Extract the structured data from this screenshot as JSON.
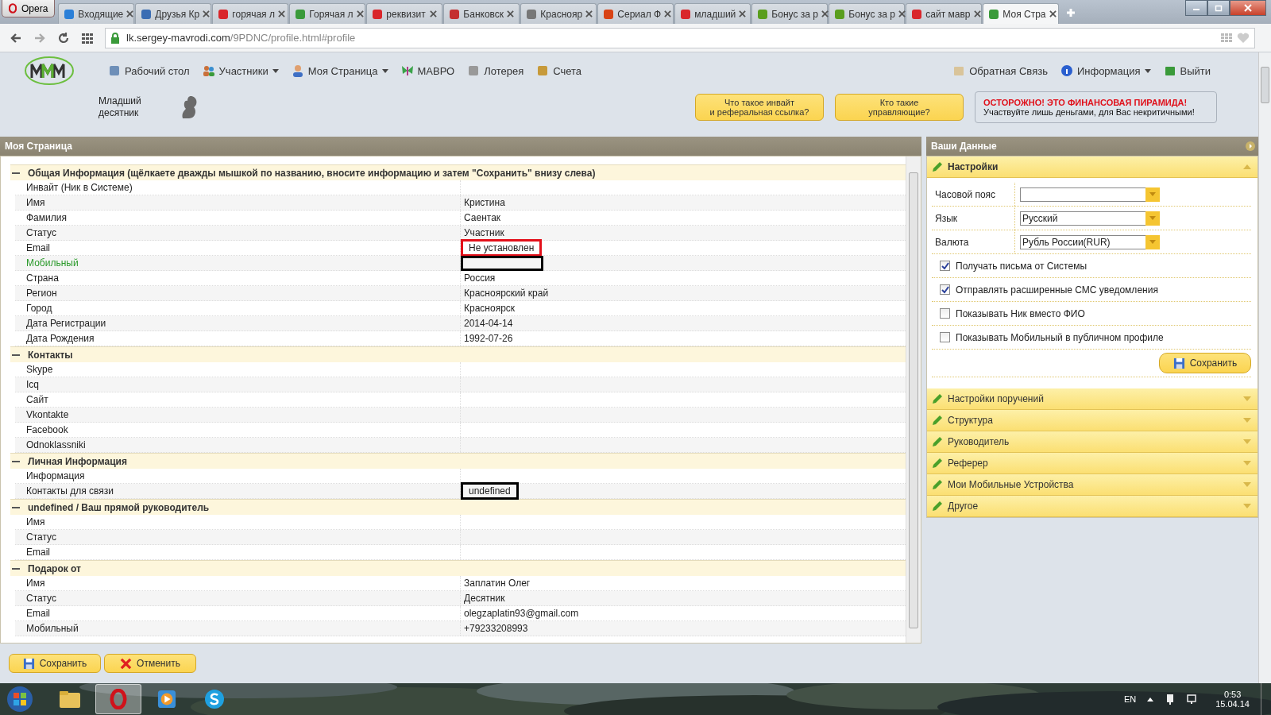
{
  "browser": {
    "menu_label": "Opera",
    "tabs": [
      {
        "label": "Входящие",
        "selected": false
      },
      {
        "label": "Друзья Кр",
        "selected": false
      },
      {
        "label": "горячая л",
        "selected": false
      },
      {
        "label": "Горячая л",
        "selected": false
      },
      {
        "label": "реквизит",
        "selected": false
      },
      {
        "label": "Банковск",
        "selected": false
      },
      {
        "label": "Краснояр",
        "selected": false
      },
      {
        "label": "Сериал Ф",
        "selected": false
      },
      {
        "label": "младший",
        "selected": false
      },
      {
        "label": "Бонус за р",
        "selected": false
      },
      {
        "label": "Бонус за р",
        "selected": false
      },
      {
        "label": "сайт мавр",
        "selected": false
      },
      {
        "label": "Моя Стра",
        "selected": true
      }
    ],
    "address": {
      "host": "lk.sergey-mavrodi.com",
      "path": "/9PDNC/profile.html#profile"
    }
  },
  "nav": {
    "left": [
      {
        "label": "Рабочий стол",
        "dropdown": false
      },
      {
        "label": "Участники",
        "dropdown": true
      },
      {
        "label": "Моя Страница",
        "dropdown": true
      },
      {
        "label": "МАВРО",
        "dropdown": false
      },
      {
        "label": "Лотерея",
        "dropdown": false
      },
      {
        "label": "Счета",
        "dropdown": false
      }
    ],
    "right": [
      {
        "label": "Обратная Связь",
        "dropdown": false
      },
      {
        "label": "Информация",
        "dropdown": true
      },
      {
        "label": "Выйти",
        "dropdown": false
      }
    ]
  },
  "rank": "Младший десятник",
  "help_buttons": [
    [
      "Что такое инвайт",
      "и реферальная ссылка?"
    ],
    [
      "Кто такие",
      "управляющие?"
    ]
  ],
  "warning": {
    "title": "ОСТОРОЖНО! ЭТО ФИНАНСОВАЯ ПИРАМИДА!",
    "text": "Участвуйте лишь деньгами, для Вас некритичными!"
  },
  "profile": {
    "title": "Моя Страница",
    "sections": [
      {
        "title": "Общая Информация (щёлкаете дважды мышкой по названию, вносите информацию и затем \"Сохранить\" внизу слева)",
        "expanded": true,
        "rows": [
          {
            "label": "Инвайт (Ник в Системе)"
          },
          {
            "label": "Имя",
            "value": "Кристина"
          },
          {
            "label": "Фамилия",
            "value": "Саентак"
          },
          {
            "label": "Статус",
            "value": "Участник"
          },
          {
            "label": "Email",
            "value": "Не установлен",
            "color": "#e3101a"
          },
          {
            "label": "Мобильный",
            "highlighted": true,
            "color": "#000000"
          },
          {
            "label": "Страна",
            "value": "Россия"
          },
          {
            "label": "Регион",
            "value": "Красноярский край"
          },
          {
            "label": "Город",
            "value": "Красноярск"
          },
          {
            "label": "Дата Регистрации",
            "value": "2014-04-14"
          },
          {
            "label": "Дата Рождения",
            "value": "1992-07-26"
          }
        ]
      },
      {
        "title": "Контакты",
        "expanded": true,
        "rows": [
          {
            "label": "Skype"
          },
          {
            "label": "Icq"
          },
          {
            "label": "Сайт"
          },
          {
            "label": "Vkontakte"
          },
          {
            "label": "Facebook"
          },
          {
            "label": "Odnoklassniki"
          }
        ]
      },
      {
        "title": "Личная Информация",
        "expanded": true,
        "rows": [
          {
            "label": "Информация"
          },
          {
            "label": "Контакты для связи",
            "value": "undefined",
            "color": "#000000"
          }
        ]
      },
      {
        "title": "undefined / Ваш прямой руководитель",
        "expanded": true,
        "rows": [
          {
            "label": "Имя"
          },
          {
            "label": "Статус"
          },
          {
            "label": "Email"
          }
        ]
      },
      {
        "title": "Подарок от",
        "expanded": true,
        "rows": [
          {
            "label": "Имя",
            "value": "Заплатин Олег"
          },
          {
            "label": "Статус",
            "value": "Десятник"
          },
          {
            "label": "Email",
            "value": "olegzaplatin93@gmail.com"
          },
          {
            "label": "Мобильный",
            "value": "+79233208993"
          }
        ]
      }
    ],
    "buttons": [
      {
        "label": "Сохранить",
        "kind": "save"
      },
      {
        "label": "Отменить",
        "kind": "cancel"
      }
    ]
  },
  "your_data": {
    "title": "Ваши Данные",
    "accordion": [
      {
        "title": "Настройки",
        "expanded": true
      },
      {
        "title": "Настройки поручений",
        "expanded": false
      },
      {
        "title": "Структура",
        "expanded": false
      },
      {
        "title": "Руководитель",
        "expanded": false
      },
      {
        "title": "Реферер",
        "expanded": false
      },
      {
        "title": "Мои Мобильные Устройства",
        "expanded": false
      },
      {
        "title": "Другое",
        "expanded": false
      }
    ],
    "settings": {
      "selects": [
        {
          "label": "Часовой пояс"
        },
        {
          "label": "Язык",
          "value": "Русский"
        },
        {
          "label": "Валюта",
          "value": "Рубль России(RUR)"
        }
      ],
      "checkboxes": [
        {
          "label": "Получать письма от Системы",
          "checked": true
        },
        {
          "label": "Отправлять расширенные СМС уведомления",
          "checked": true
        },
        {
          "label": "Показывать Ник вместо ФИО",
          "checked": false
        },
        {
          "label": "Показывать Мобильный в публичном профиле",
          "checked": false
        }
      ],
      "save_label": "Сохранить"
    }
  },
  "taskbar": {
    "language": "EN",
    "time": "0:53",
    "date": "15.04.14"
  }
}
